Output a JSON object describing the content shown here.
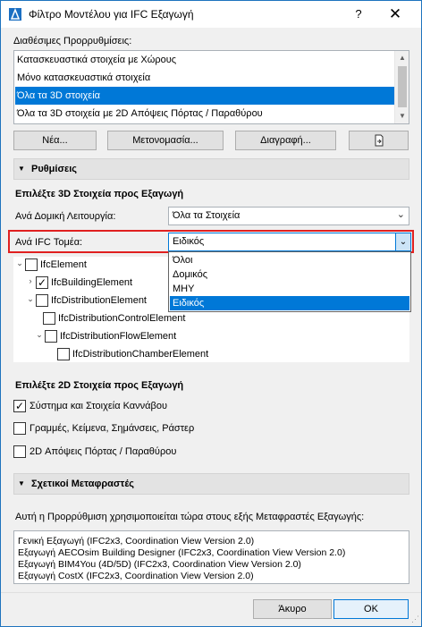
{
  "window": {
    "title": "Φίλτρο Μοντέλου για IFC Εξαγωγή",
    "help_label": "?",
    "close_label": "✕"
  },
  "presets": {
    "label": "Διαθέσιμες Προρρυθμίσεις:",
    "items": [
      {
        "label": "Κατασκευαστικά στοιχεία με Χώρους",
        "selected": false
      },
      {
        "label": "Μόνο κατασκευαστικά στοιχεία",
        "selected": false
      },
      {
        "label": "Όλα τα 3D στοιχεία",
        "selected": true
      },
      {
        "label": "Όλα τα 3D στοιχεία με 2D Απόψεις Πόρτας / Παραθύρου",
        "selected": false
      }
    ],
    "buttons": {
      "new": "Νέα...",
      "rename": "Μετονομασία...",
      "delete": "Διαγραφή...",
      "import_icon": "import-file-icon"
    }
  },
  "settings": {
    "section_title": "Ρυθμίσεις",
    "select3d_title": "Επιλέξτε 3D Στοιχεία προς Εξαγωγή",
    "structural_function_label": "Ανά Δομική Λειτουργία:",
    "structural_function_value": "Όλα τα Στοιχεία",
    "ifc_domain_label": "Ανά IFC Τομέα:",
    "ifc_domain_value": "Ειδικός",
    "ifc_domain_options": [
      "Όλοι",
      "Δομικός",
      "ΜΗΥ",
      "Ειδικός"
    ],
    "ifc_domain_selected_index": 3,
    "highlight_color": "#e02020",
    "tree": [
      {
        "label": "IfcElement",
        "expander": "collapse",
        "checked": false,
        "level": 0
      },
      {
        "label": "IfcBuildingElement",
        "expander": "expand",
        "checked": true,
        "level": 1
      },
      {
        "label": "IfcDistributionElement",
        "expander": "collapse",
        "checked": false,
        "level": 1
      },
      {
        "label": "IfcDistributionControlElement",
        "expander": "none",
        "checked": false,
        "level": 2
      },
      {
        "label": "IfcDistributionFlowElement",
        "expander": "collapse",
        "checked": false,
        "level": 2
      },
      {
        "label": "IfcDistributionChamberElement",
        "expander": "none",
        "checked": false,
        "level": 3
      }
    ],
    "select2d_title": "Επιλέξτε 2D Στοιχεία προς Εξαγωγή",
    "options_2d": [
      {
        "label": "Σύστημα και Στοιχεία Καννάβου",
        "checked": true
      },
      {
        "label": "Γραμμές, Κείμενα, Σημάνσεις, Ράστερ",
        "checked": false
      },
      {
        "label": "2D Απόψεις Πόρτας / Παραθύρου",
        "checked": false
      }
    ]
  },
  "translators": {
    "section_title": "Σχετικοί Μεταφραστές",
    "description": "Αυτή η Προρρύθμιση χρησιμοποιείται τώρα στους εξής Μεταφραστές Εξαγωγής:",
    "items": [
      "Γενική Εξαγωγή (IFC2x3, Coordination View Version 2.0)",
      "Εξαγωγή AECOsim Building Designer (IFC2x3, Coordination View Version 2.0)",
      "Εξαγωγή BIM4You (4D/5D) (IFC2x3, Coordination View Version 2.0)",
      "Εξαγωγή CostX (IFC2x3, Coordination View Version 2.0)"
    ]
  },
  "footer": {
    "cancel": "Άκυρο",
    "ok": "OK"
  },
  "colors": {
    "accent": "#0078d7",
    "selection": "#0078d7"
  }
}
